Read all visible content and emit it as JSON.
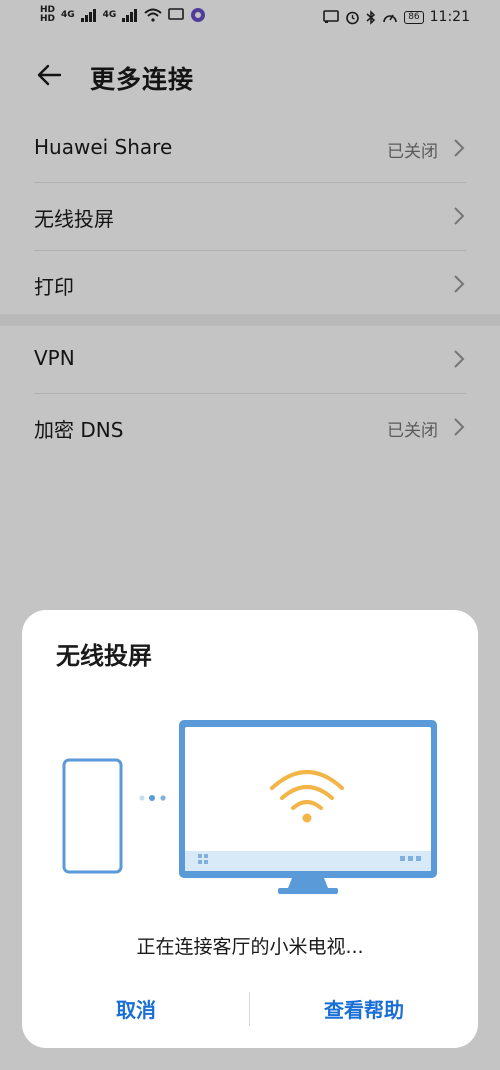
{
  "status_bar": {
    "left_labels": [
      "HD",
      "HD",
      "4G",
      "4G"
    ],
    "battery": "86",
    "time": "11:21"
  },
  "header": {
    "title": "更多连接"
  },
  "settings": {
    "group1": [
      {
        "label": "Huawei Share",
        "value": "已关闭"
      },
      {
        "label": "无线投屏",
        "value": ""
      },
      {
        "label": "打印",
        "value": ""
      }
    ],
    "group2": [
      {
        "label": "VPN",
        "value": ""
      },
      {
        "label": "加密 DNS",
        "value": "已关闭"
      }
    ]
  },
  "dialog": {
    "title": "无线投屏",
    "status_text": "正在连接客厅的小米电视...",
    "cancel_label": "取消",
    "help_label": "查看帮助"
  },
  "colors": {
    "accent": "#1a6fd6",
    "illustration_blue": "#5b9ad8",
    "illustration_light": "#d8e9f8",
    "wifi_orange": "#f4b548"
  }
}
